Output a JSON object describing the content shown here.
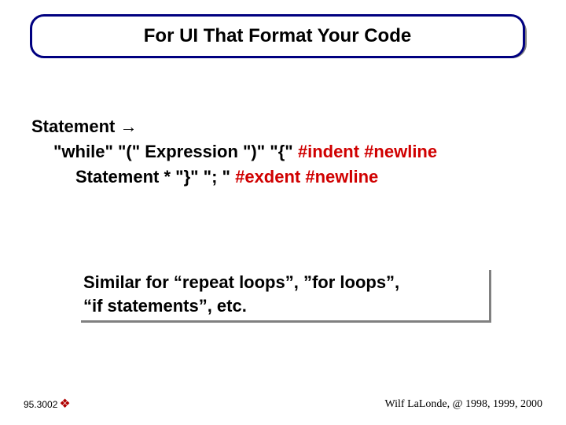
{
  "title": "For UI That Format Your Code",
  "grammar": {
    "line1_label": "Statement",
    "line1_arrow": "→",
    "line2_plain": "\"while\" \"(\" Expression \")\" \"{\" ",
    "line2_red": "#indent #newline",
    "line3_plain": "Statement * \"}\" \"; \" ",
    "line3_red": "#exdent #newline"
  },
  "note_line1": "Similar for “repeat loops”, ”for loops”,",
  "note_line2": "“if statements”, etc.",
  "footer": {
    "left_code": "95.3002",
    "marker": "❖",
    "right_text": "Wilf LaLonde, @ 1998, 1999, 2000"
  }
}
